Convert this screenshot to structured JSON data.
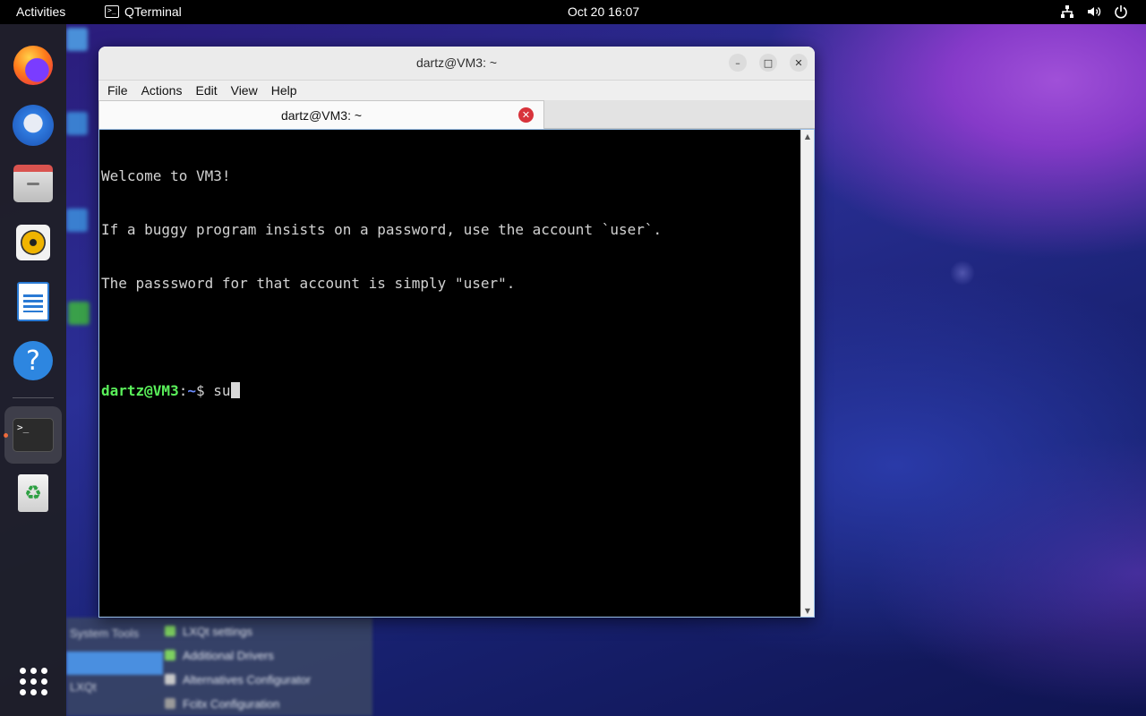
{
  "topbar": {
    "activities": "Activities",
    "app_name": "QTerminal",
    "app_icon_glyph": ">_",
    "clock": "Oct 20  16:07",
    "tray_icons": [
      "network-icon",
      "volume-icon",
      "power-icon"
    ]
  },
  "dock": {
    "items": [
      {
        "name": "firefox-icon",
        "running": false
      },
      {
        "name": "thunderbird-icon",
        "running": false
      },
      {
        "name": "files-icon",
        "running": false
      },
      {
        "name": "rhythmbox-icon",
        "running": false
      },
      {
        "name": "libreoffice-writer-icon",
        "running": false
      },
      {
        "name": "help-icon",
        "glyph": "?",
        "running": false
      },
      {
        "name": "terminal-icon",
        "glyph": ">_",
        "running": true
      },
      {
        "name": "trash-icon",
        "glyph": "♻",
        "running": false
      },
      {
        "name": "show-apps-icon",
        "running": false
      }
    ]
  },
  "window": {
    "title": "dartz@VM3: ~",
    "controls": {
      "minimize": "–",
      "maximize": "□",
      "close": "✕"
    },
    "menu": [
      "File",
      "Actions",
      "Edit",
      "View",
      "Help"
    ],
    "tab": {
      "label": "dartz@VM3: ~",
      "close": "✕"
    },
    "terminal": {
      "lines": [
        "Welcome to VM3!",
        "If a buggy program insists on a password, use the account `user`.",
        "The passsword for that account is simply \"user\".",
        ""
      ],
      "prompt_user": "dartz@VM3",
      "prompt_sep": ":",
      "prompt_path": "~",
      "prompt_symbol": "$ ",
      "command": "su"
    },
    "scrollbar": {
      "up": "▲",
      "down": "▼"
    }
  },
  "background_menu": {
    "left_items": [
      "System Tools",
      "LXQt"
    ],
    "right_items": [
      "LXQt settings",
      "Additional Drivers",
      "Alternatives Configurator",
      "Fcitx Configuration"
    ]
  },
  "colors": {
    "prompt_user": "#5af05a",
    "prompt_path": "#6b8cff",
    "terminal_bg": "#000000",
    "tab_close": "#d8333b"
  }
}
